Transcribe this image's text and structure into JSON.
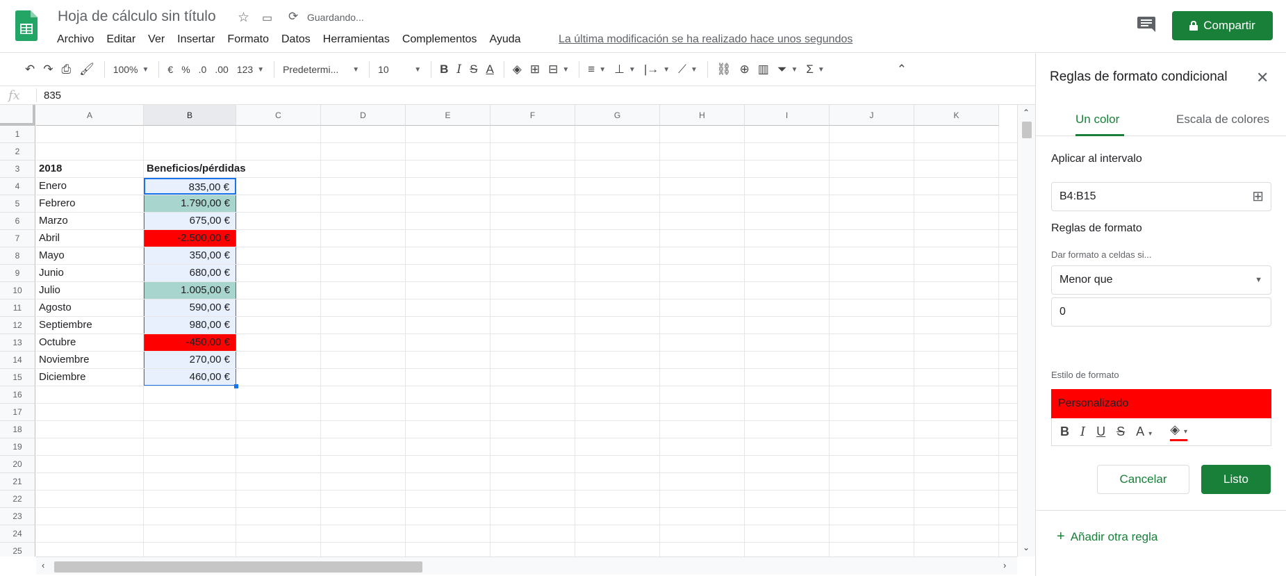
{
  "header": {
    "doc_title": "Hoja de cálculo sin título",
    "saving": "Guardando...",
    "menu": [
      "Archivo",
      "Editar",
      "Ver",
      "Insertar",
      "Formato",
      "Datos",
      "Herramientas",
      "Complementos",
      "Ayuda"
    ],
    "last_modified": "La última modificación se ha realizado hace unos segundos",
    "share_label": "Compartir"
  },
  "toolbar": {
    "zoom": "100%",
    "currency": "€",
    "percent": "%",
    "dec_less": ".0",
    "dec_more": ".00",
    "format_more": "123",
    "font": "Predetermi...",
    "font_size": "10"
  },
  "formula_bar": {
    "fx": "fx",
    "value": "835"
  },
  "grid": {
    "columns": [
      "A",
      "B",
      "C",
      "D",
      "E",
      "F",
      "G",
      "H",
      "I",
      "J",
      "K"
    ],
    "rows": [
      "1",
      "2",
      "3",
      "4",
      "5",
      "6",
      "7",
      "8",
      "9",
      "10",
      "11",
      "12",
      "13",
      "14",
      "15",
      "16",
      "17",
      "18",
      "19",
      "20",
      "21",
      "22",
      "23",
      "24",
      "25"
    ],
    "header_row": {
      "a": "2018",
      "b": "Beneficios/pérdidas"
    },
    "data": [
      {
        "a": "Enero",
        "b": "835,00 €",
        "fill": "#e8f0fe"
      },
      {
        "a": "Febrero",
        "b": "1.790,00 €",
        "fill": "#a8d5cd"
      },
      {
        "a": "Marzo",
        "b": "675,00 €",
        "fill": "#e8f0fe"
      },
      {
        "a": "Abril",
        "b": "-2.500,00 €",
        "fill": "#ff0000"
      },
      {
        "a": "Mayo",
        "b": "350,00 €",
        "fill": "#e8f0fe"
      },
      {
        "a": "Junio",
        "b": "680,00 €",
        "fill": "#e8f0fe"
      },
      {
        "a": "Julio",
        "b": "1.005,00 €",
        "fill": "#a8d5cd"
      },
      {
        "a": "Agosto",
        "b": "590,00 €",
        "fill": "#e8f0fe"
      },
      {
        "a": "Septiembre",
        "b": "980,00 €",
        "fill": "#e8f0fe"
      },
      {
        "a": "Octubre",
        "b": "-450,00 €",
        "fill": "#ff0000"
      },
      {
        "a": "Noviembre",
        "b": "270,00 €",
        "fill": "#e8f0fe"
      },
      {
        "a": "Diciembre",
        "b": "460,00 €",
        "fill": "#e8f0fe"
      }
    ]
  },
  "panel": {
    "title": "Reglas de formato condicional",
    "tab_single": "Un color",
    "tab_scale": "Escala de colores",
    "apply_range_label": "Aplicar al intervalo",
    "range_value": "B4:B15",
    "rules_label": "Reglas de formato",
    "condition_label": "Dar formato a celdas si...",
    "condition_value": "Menor que",
    "condition_input": "0",
    "style_label": "Estilo de formato",
    "preview_label": "Personalizado",
    "preview_color": "#ff0000",
    "cancel_label": "Cancelar",
    "done_label": "Listo",
    "add_rule_label": "Añadir otra regla"
  },
  "colors": {
    "accent": "#188038"
  }
}
